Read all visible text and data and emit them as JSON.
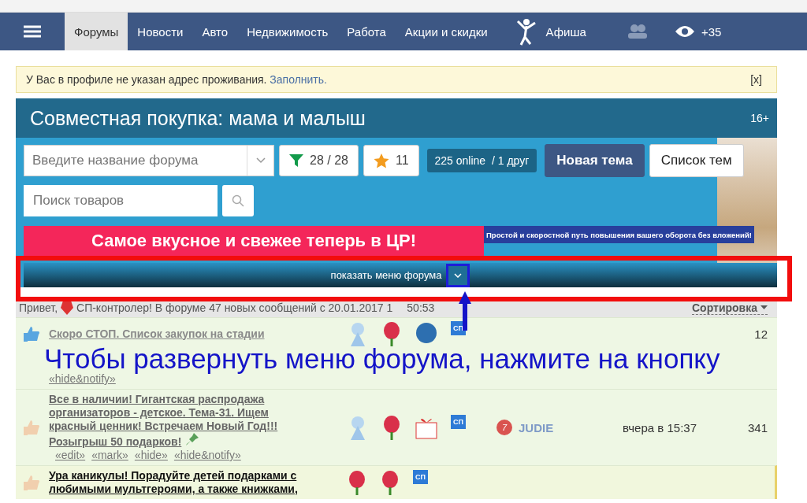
{
  "nav": {
    "items": [
      {
        "kind": "menu",
        "selected": false
      },
      {
        "kind": "link",
        "label": "Форумы",
        "selected": true
      },
      {
        "kind": "link",
        "label": "Новости",
        "selected": false
      },
      {
        "kind": "link",
        "label": "Авто",
        "selected": false
      },
      {
        "kind": "link",
        "label": "Недвижимость",
        "selected": false
      },
      {
        "kind": "link",
        "label": "Работа",
        "selected": false
      },
      {
        "kind": "link",
        "label": "Акции и скидки",
        "selected": false
      },
      {
        "kind": "afisha",
        "label": "Афиша",
        "selected": false
      },
      {
        "kind": "friends",
        "selected": false
      },
      {
        "kind": "views",
        "label": "+35",
        "selected": false
      }
    ]
  },
  "notice": {
    "text": "У Вас в профиле не указан адрес проживания.",
    "link": "Заполнить.",
    "close": "[x]"
  },
  "forum": {
    "title": "Совместная покупка: мама и малыш",
    "age": "16+",
    "search_placeholder": "Введите название форума",
    "filter": "28 / 28",
    "favorites": "11",
    "online": "225 online  / 1 друг",
    "buttons": [
      "Новая тема",
      "Список тем"
    ],
    "goods_placeholder": "Поиск товаров",
    "banner_left": "Самое вкусное и свежее теперь в ЦР!",
    "banner_right": "Простой и скоростной путь повышения вашего оборота без вложений!",
    "menu_toggle": "показать меню форума"
  },
  "annotation": {
    "caption": "Чтобы развернуть меню форума, нажмите на кнопку"
  },
  "greeting": {
    "before": "Привет,",
    "text": "СП-контролер! В форуме 47 новых сообщений с 20.01.2017 1",
    "after": "50:53",
    "sort": "Сортировка"
  },
  "topics": [
    {
      "kind": "faded",
      "unread": false,
      "title": "Скоро СТОП. Список закупок на стадии",
      "pinned": false,
      "links": [
        "«hide&notify»"
      ],
      "pictures": [
        {
          "kind": "figure"
        },
        {
          "kind": "flower"
        },
        {
          "kind": "ball"
        },
        {
          "kind": "sp",
          "label": "СП"
        }
      ],
      "count": "12"
    },
    {
      "kind": "normal",
      "unread": false,
      "title": "Все в наличии! Гигантская распродажа организаторов - детское. Тема-31. Ищем красный ценник! Встречаем Новый Год!!! Розыгрыш 50 подарков!",
      "pinned": true,
      "links": [
        "«edit»",
        "«mark»",
        "«hide»",
        "«hide&notify»"
      ],
      "pictures": [
        {
          "kind": "figure"
        },
        {
          "kind": "flower"
        },
        {
          "kind": "gift"
        },
        {
          "kind": "sp",
          "label": "СП"
        }
      ],
      "user": "JUDIE",
      "level": "7",
      "time": "вчера в 15:37",
      "count": "341"
    },
    {
      "kind": "normal",
      "unread": true,
      "title": "Ура каникулы! Порадуйте детей подарками с любимыми мультгероями, а также книжками,",
      "pinned": false,
      "pictures": [
        {
          "kind": "flower"
        },
        {
          "kind": "flower"
        },
        {
          "kind": "sp",
          "label": "СП"
        }
      ]
    }
  ]
}
